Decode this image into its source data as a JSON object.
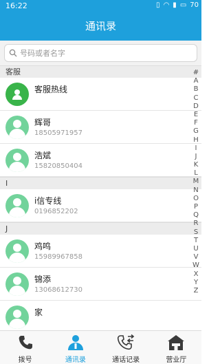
{
  "status_bar": {
    "time": "16:22",
    "battery": "70"
  },
  "title": "通讯录",
  "search": {
    "placeholder": "号码或者名字"
  },
  "sections": [
    {
      "header": "客服",
      "contacts": [
        {
          "name": "客服热线",
          "phone": "",
          "avatar": "service-icon"
        },
        {
          "name": "辉哥",
          "phone": "18505971957",
          "avatar": "person-icon"
        },
        {
          "name": "浩斌",
          "phone": "15820850404",
          "avatar": "person-icon"
        }
      ]
    },
    {
      "header": "I",
      "contacts": [
        {
          "name": "i信专线",
          "phone": "0196852202",
          "avatar": "person-icon"
        }
      ]
    },
    {
      "header": "J",
      "contacts": [
        {
          "name": "鸡鸣",
          "phone": "15989967858",
          "avatar": "person-icon"
        },
        {
          "name": "锦添",
          "phone": "13068612730",
          "avatar": "person-icon"
        },
        {
          "name": "家",
          "phone": "",
          "avatar": "person-icon"
        }
      ]
    }
  ],
  "index_letters": [
    "#",
    "A",
    "B",
    "C",
    "D",
    "E",
    "F",
    "G",
    "H",
    "I",
    "J",
    "K",
    "L",
    "M",
    "N",
    "O",
    "P",
    "Q",
    "R",
    "S",
    "T",
    "U",
    "V",
    "W",
    "X",
    "Y",
    "Z"
  ],
  "tabs": [
    {
      "label": "拨号",
      "icon": "phone-icon",
      "active": false
    },
    {
      "label": "通讯录",
      "icon": "contacts-icon",
      "active": true
    },
    {
      "label": "通话记录",
      "icon": "call-log-icon",
      "active": false
    },
    {
      "label": "营业厅",
      "icon": "store-icon",
      "active": false
    }
  ],
  "colors": {
    "primary": "#1ea0dc",
    "avatar": "#72d39b",
    "service_avatar": "#39b44a"
  }
}
